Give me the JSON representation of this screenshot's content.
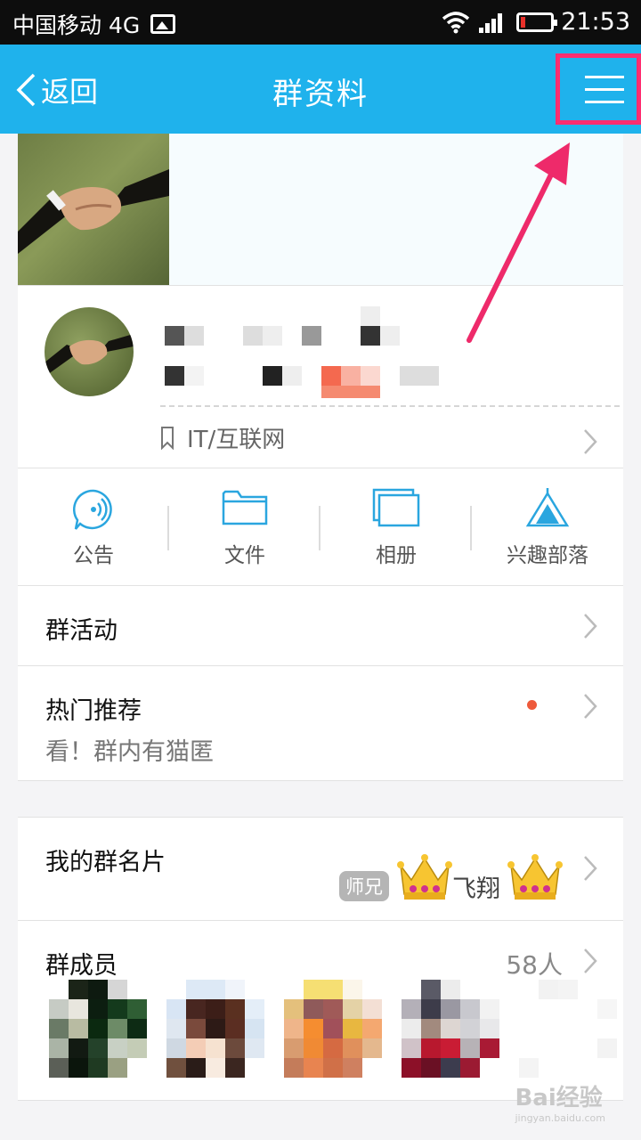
{
  "status_bar": {
    "carrier": "中国移动 4G",
    "time": "21:53"
  },
  "nav": {
    "back_label": "返回",
    "title": "群资料"
  },
  "group": {
    "category": "IT/互联网"
  },
  "actions": [
    {
      "label": "公告",
      "icon": "announcement-icon"
    },
    {
      "label": "文件",
      "icon": "folder-icon"
    },
    {
      "label": "相册",
      "icon": "album-icon"
    },
    {
      "label": "兴趣部落",
      "icon": "tent-icon"
    }
  ],
  "rows": {
    "activity": {
      "title": "群活动"
    },
    "recommend": {
      "title": "热门推荐",
      "subtitle": "看！群内有猫匿"
    },
    "card": {
      "title": "我的群名片",
      "tag": "师兄",
      "nickname": "飞翔"
    },
    "members": {
      "title": "群成员",
      "count": "58人"
    }
  },
  "watermark": {
    "brand": "Bai经验",
    "url": "jingyan.baidu.com"
  },
  "colors": {
    "header": "#1fb2ec",
    "highlight": "#ff2d70",
    "icon": "#2aa6df",
    "dot": "#ee5a3b"
  }
}
